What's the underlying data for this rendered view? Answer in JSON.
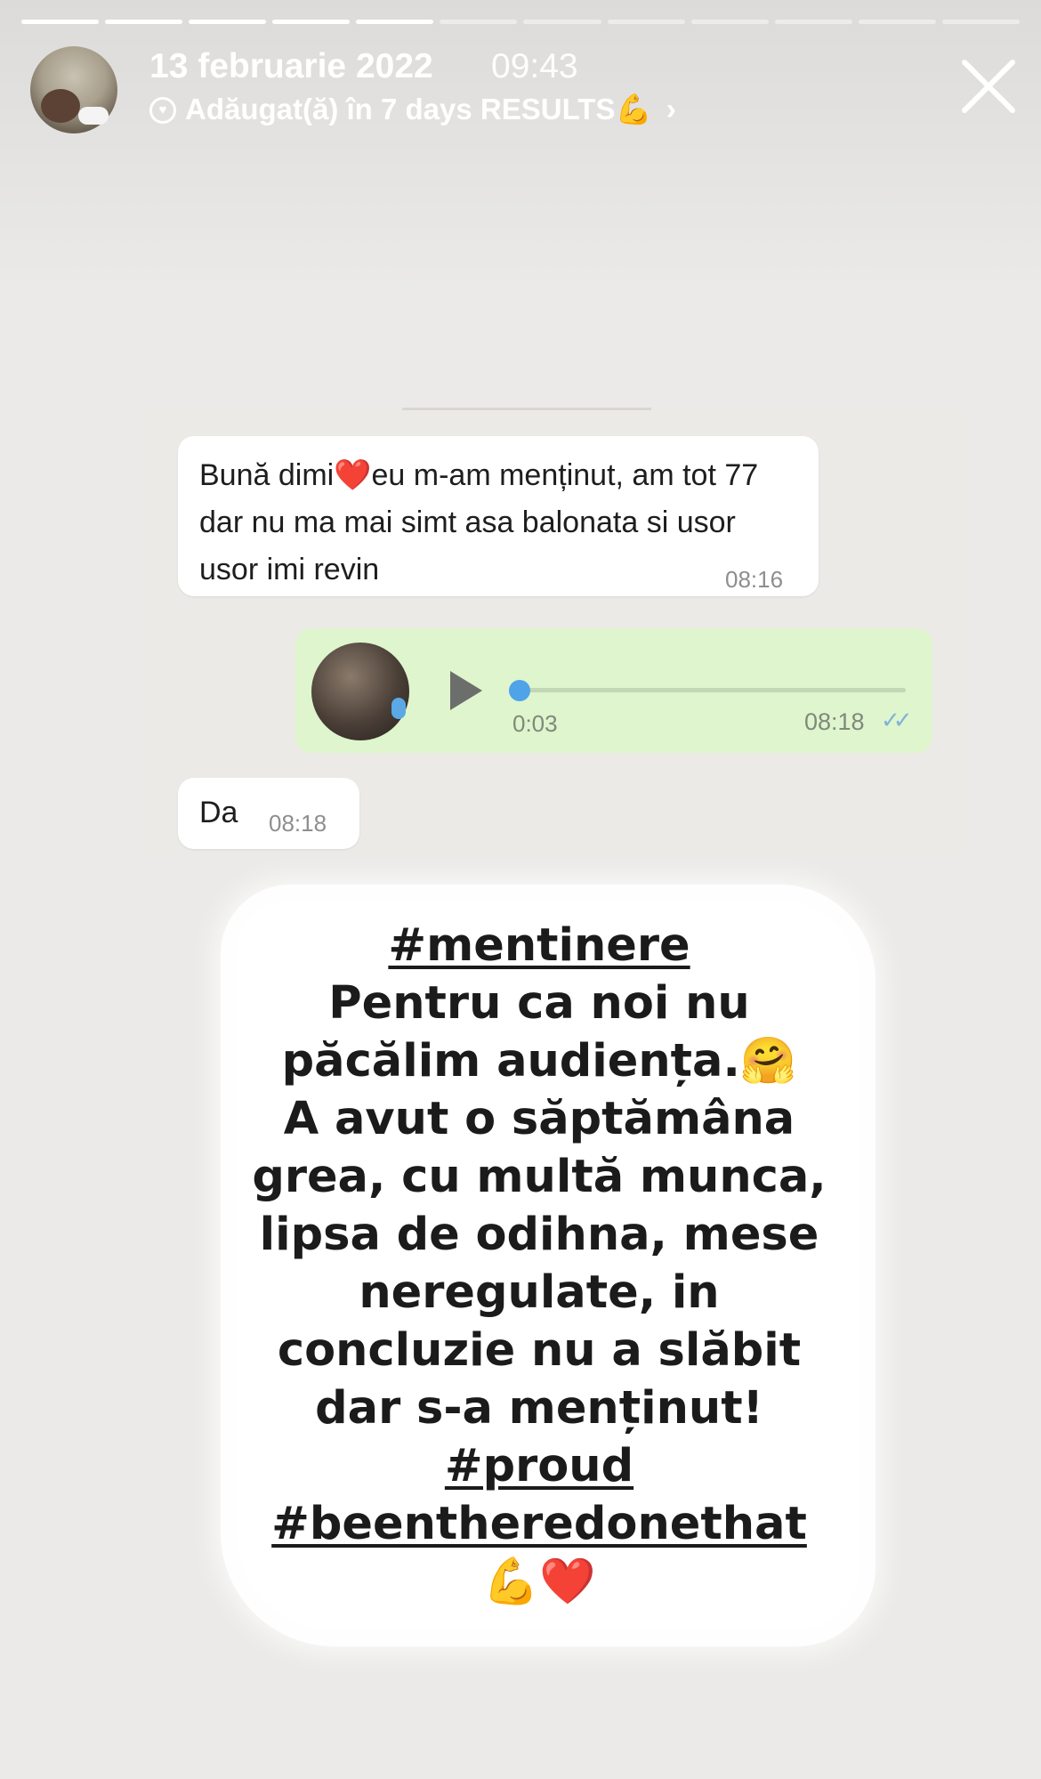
{
  "story": {
    "segments_total": 12,
    "segments_done": 5,
    "date": "13 februarie 2022",
    "time": "09:43",
    "added_label": "Adăugat(ă) în 7 days RESULTS💪",
    "chevron": "›",
    "close_icon": "close-icon"
  },
  "chat": {
    "messages": [
      {
        "text": "Bună dimi❤️eu m-am menținut, am tot 77 dar nu ma mai simt asa balonata si usor usor imi revin",
        "time": "08:16"
      },
      {
        "type": "voice",
        "duration": "0:03",
        "time": "08:18",
        "ticks": "✓✓"
      },
      {
        "text": "Da",
        "time": "08:18"
      }
    ]
  },
  "caption": {
    "lines": [
      "#mentinere",
      "Pentru ca noi nu",
      "păcălim audiența.🤗",
      "A avut o săptămâna",
      "grea, cu multă munca,",
      "lipsa de odihna, mese",
      "neregulate, in",
      "concluzie nu a slăbit",
      "dar s-a menținut!",
      "#proud",
      "#beentheredonethat",
      "💪❤️"
    ]
  },
  "colors": {
    "background": "#ebeae8",
    "voice_bubble": "#dff5cd",
    "play_knob": "#4fa3e9"
  }
}
